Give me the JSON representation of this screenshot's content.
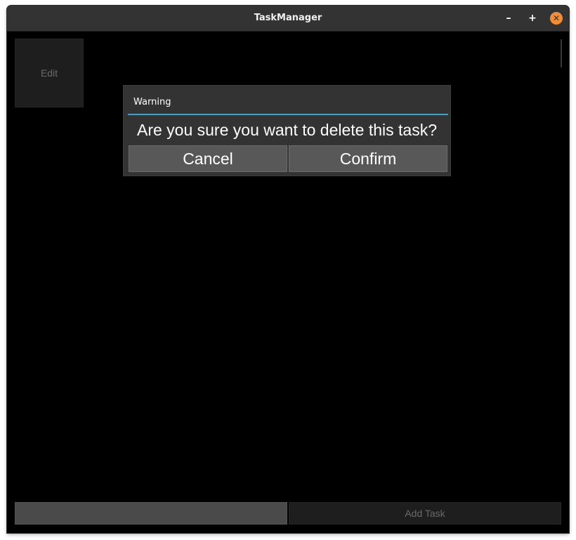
{
  "window": {
    "title": "TaskManager",
    "minimize_glyph": "–",
    "maximize_glyph": "+",
    "close_glyph": "✕",
    "close_color": "#f58c33"
  },
  "task_item": {
    "edit_label": "Edit"
  },
  "dialog": {
    "title": "Warning",
    "message": "Are you sure you want to delete this task?",
    "cancel_label": "Cancel",
    "confirm_label": "Confirm",
    "accent_color": "#33a4d4"
  },
  "footer": {
    "input_value": "",
    "input_placeholder": "",
    "add_label": "Add Task"
  }
}
